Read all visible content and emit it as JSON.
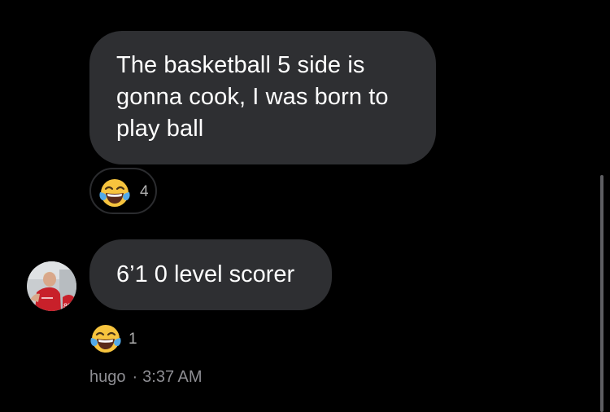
{
  "messages": [
    {
      "lines": [
        "The basketball 5 side is",
        "gonna cook, I was born to",
        "play ball"
      ],
      "reaction": {
        "icon": "tears-of-joy-emoji",
        "count": "4"
      }
    },
    {
      "text": "6’1 0 level scorer",
      "reaction": {
        "icon": "tears-of-joy-emoji",
        "count": "1"
      },
      "sender": "hugo",
      "separator": "·",
      "time": "3:37 AM"
    }
  ],
  "colors": {
    "background": "#000000",
    "bubble": "#2e2f32",
    "text": "#ffffff",
    "meta": "#8e8e93",
    "emoji_face": "#f7c43e"
  }
}
